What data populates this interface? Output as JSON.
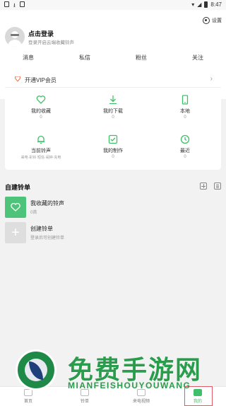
{
  "status_bar": {
    "time": "8:47"
  },
  "header": {
    "login_title": "点击登录",
    "login_sub": "登录开启云端收藏铃声",
    "settings_label": "设置"
  },
  "stats": [
    "消息",
    "私信",
    "粉丝",
    "关注"
  ],
  "vip": {
    "label": "开通VIP会员",
    "arrow": "›"
  },
  "grid": [
    {
      "label": "我的收藏",
      "count": "0",
      "icon": "heart-icon",
      "sub": ""
    },
    {
      "label": "我的下载",
      "count": "0",
      "icon": "download-icon",
      "sub": ""
    },
    {
      "label": "本地",
      "count": "0",
      "icon": "phone-icon",
      "sub": ""
    },
    {
      "label": "当前铃声",
      "count": "",
      "icon": "bell-icon",
      "sub": "来电·彩铃·短信·闹钟·充电"
    },
    {
      "label": "我的制作",
      "count": "0",
      "icon": "edit-check-icon",
      "sub": ""
    },
    {
      "label": "最近",
      "count": "0",
      "icon": "clock-icon",
      "sub": ""
    }
  ],
  "playlist": {
    "title": "自建铃单",
    "items": [
      {
        "name": "我收藏的铃声",
        "sub": "0首"
      },
      {
        "name": "创建铃单",
        "sub": "登录后可创建铃单"
      }
    ]
  },
  "tabbar": [
    {
      "label": "首页"
    },
    {
      "label": "铃单"
    },
    {
      "label": "来电视频"
    },
    {
      "label": "我的",
      "active": true
    }
  ],
  "watermark": {
    "text": "免费手游网",
    "pinyin": "MIANFEISHOUYOUWANG"
  },
  "colors": {
    "accent": "#3fbf6a",
    "vip": "#e8643c",
    "highlight": "#e05a6a"
  }
}
